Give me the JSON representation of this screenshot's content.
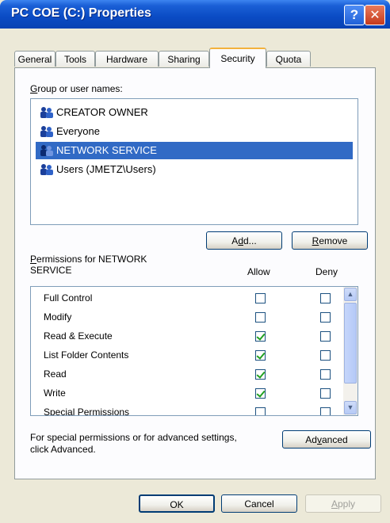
{
  "window": {
    "title": "PC COE (C:) Properties",
    "help_glyph": "?",
    "close_glyph": "✕"
  },
  "tabs": [
    {
      "label": "General"
    },
    {
      "label": "Tools"
    },
    {
      "label": "Hardware"
    },
    {
      "label": "Sharing"
    },
    {
      "label": "Security",
      "active": true
    },
    {
      "label": "Quota"
    }
  ],
  "security": {
    "group_label_first": "G",
    "group_label_rest": "roup or user names:",
    "users": [
      {
        "name": "CREATOR OWNER",
        "selected": false
      },
      {
        "name": "Everyone",
        "selected": false
      },
      {
        "name": "NETWORK SERVICE",
        "selected": true
      },
      {
        "name": "Users (JMETZ\\Users)",
        "selected": false
      }
    ],
    "add_button": {
      "pre": "A",
      "u": "d",
      "post": "d..."
    },
    "remove_button": {
      "u": "R",
      "post": "emove"
    },
    "permissions_label": {
      "u": "P",
      "line1": "ermissions for NETWORK",
      "line2": "SERVICE"
    },
    "allow_header": "Allow",
    "deny_header": "Deny",
    "permissions": [
      {
        "name": "Full Control",
        "allow": false,
        "deny": false
      },
      {
        "name": "Modify",
        "allow": false,
        "deny": false
      },
      {
        "name": "Read & Execute",
        "allow": true,
        "deny": false
      },
      {
        "name": "List Folder Contents",
        "allow": true,
        "deny": false
      },
      {
        "name": "Read",
        "allow": true,
        "deny": false
      },
      {
        "name": "Write",
        "allow": true,
        "deny": false
      },
      {
        "name": "Special Permissions",
        "allow": false,
        "deny": false
      }
    ],
    "advanced_text_line1": "For special permissions or for advanced settings,",
    "advanced_text_line2": "click Advanced.",
    "advanced_button": {
      "pre": "Ad",
      "u": "v",
      "post": "anced"
    }
  },
  "footer": {
    "ok": "OK",
    "cancel": "Cancel",
    "apply_u": "A",
    "apply_rest": "pply"
  },
  "colors": {
    "selection": "#316ac5",
    "titlebar": "#0a4bc4",
    "dialog_bg": "#ece9d8"
  }
}
